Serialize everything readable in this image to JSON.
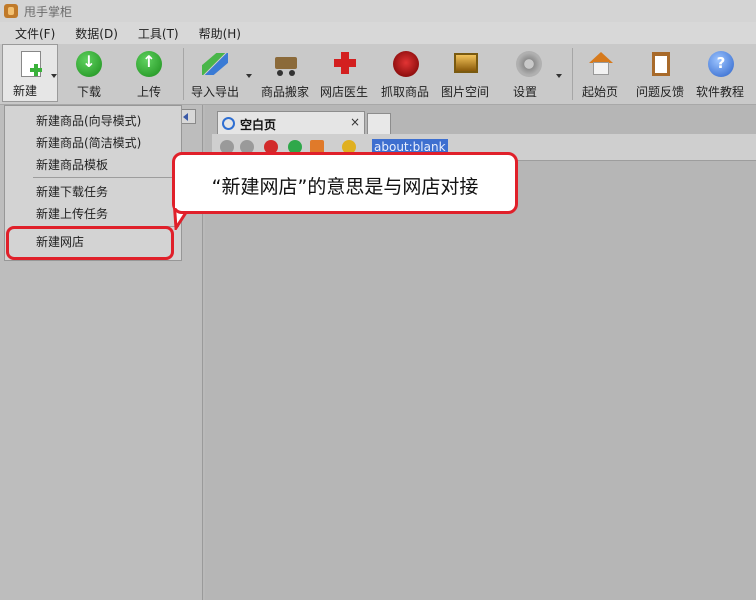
{
  "window": {
    "title": "甩手掌柜"
  },
  "menubar": [
    {
      "label": "文件(F)"
    },
    {
      "label": "数据(D)"
    },
    {
      "label": "工具(T)"
    },
    {
      "label": "帮助(H)"
    }
  ],
  "toolbar": {
    "new": "新建",
    "download": "下载",
    "upload": "上传",
    "import_export": "导入导出",
    "move_goods": "商品搬家",
    "shop_doctor": "网店医生",
    "grab_goods": "抓取商品",
    "image_space": "图片空间",
    "settings": "设置",
    "home": "起始页",
    "feedback": "问题反馈",
    "tutorial": "软件教程"
  },
  "new_menu": {
    "items": [
      {
        "label": "新建商品(向导模式)"
      },
      {
        "label": "新建商品(简洁模式)"
      },
      {
        "label": "新建商品模板"
      },
      {
        "label": "新建下载任务"
      },
      {
        "label": "新建上传任务"
      },
      {
        "label": "新建网店"
      }
    ]
  },
  "browser": {
    "tab_title": "空白页",
    "tab_close": "×",
    "address": "about:blank"
  },
  "annotation": {
    "text": "“新建网店”的意思是与网店对接"
  },
  "colors": {
    "highlight_red": "#e0202a",
    "address_selection": "#3d6fd0"
  }
}
